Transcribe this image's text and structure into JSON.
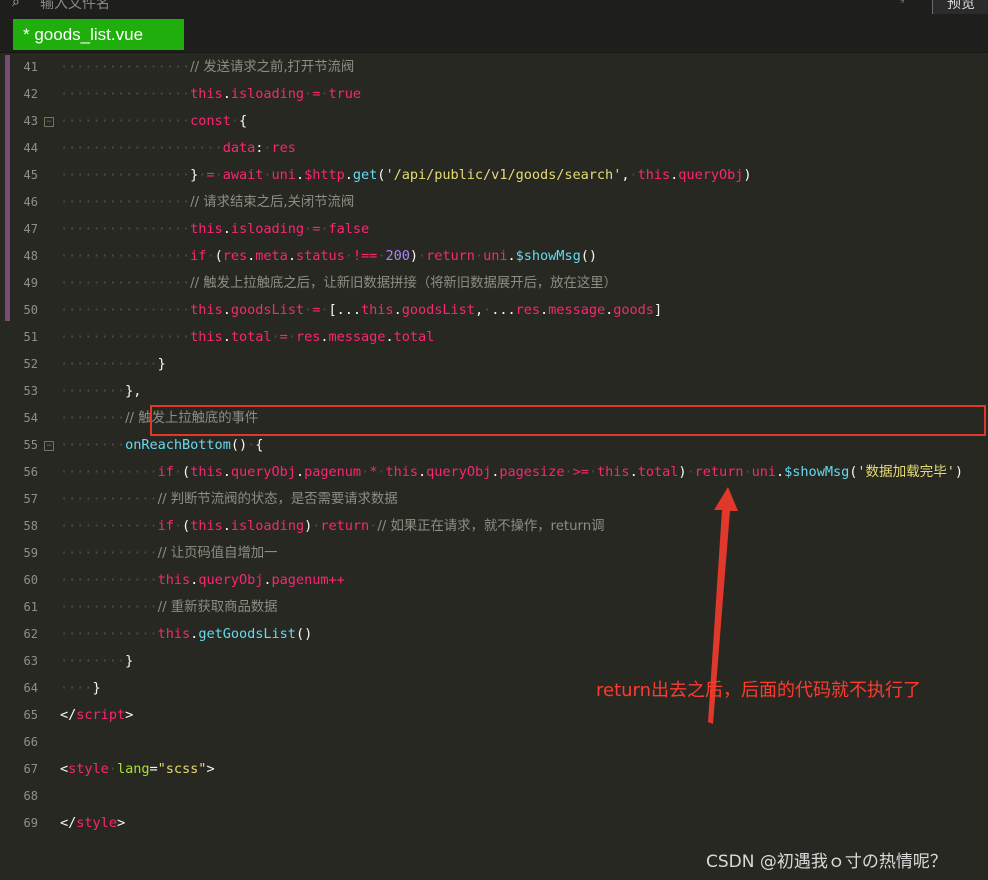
{
  "toolbar": {
    "search_placeholder": "输入文件名",
    "preview_label": "预览"
  },
  "tab": {
    "label": "* goods_list.vue"
  },
  "lines": [
    {
      "num": "41",
      "fold": false,
      "tokens": [
        [
          "ind",
          "················"
        ],
        [
          "cm",
          "// 发送请求之前,打开节流阀"
        ]
      ]
    },
    {
      "num": "42",
      "fold": false,
      "tokens": [
        [
          "ind",
          "················"
        ],
        [
          "kw",
          "this"
        ],
        [
          "pl",
          "."
        ],
        [
          "prop",
          "isloading"
        ],
        [
          "ind",
          "·"
        ],
        [
          "op",
          "="
        ],
        [
          "ind",
          "·"
        ],
        [
          "bool",
          "true"
        ]
      ]
    },
    {
      "num": "43",
      "fold": true,
      "tokens": [
        [
          "ind",
          "················"
        ],
        [
          "kw",
          "const"
        ],
        [
          "ind",
          "·"
        ],
        [
          "pl",
          "{"
        ]
      ]
    },
    {
      "num": "44",
      "fold": false,
      "tokens": [
        [
          "ind",
          "····················"
        ],
        [
          "prop",
          "data"
        ],
        [
          "pl",
          ":"
        ],
        [
          "ind",
          "·"
        ],
        [
          "var",
          "res"
        ]
      ]
    },
    {
      "num": "45",
      "fold": false,
      "tokens": [
        [
          "ind",
          "················"
        ],
        [
          "pl",
          "}"
        ],
        [
          "ind",
          "·"
        ],
        [
          "op",
          "="
        ],
        [
          "ind",
          "·"
        ],
        [
          "kw",
          "await"
        ],
        [
          "ind",
          "·"
        ],
        [
          "var",
          "uni"
        ],
        [
          "pl",
          "."
        ],
        [
          "var",
          "$http"
        ],
        [
          "pl",
          "."
        ],
        [
          "fn",
          "get"
        ],
        [
          "pl",
          "("
        ],
        [
          "str",
          "'/api/public/v1/goods/search'"
        ],
        [
          "pl",
          ","
        ],
        [
          "ind",
          "·"
        ],
        [
          "kw",
          "this"
        ],
        [
          "pl",
          "."
        ],
        [
          "prop",
          "queryObj"
        ],
        [
          "pl",
          ")"
        ]
      ]
    },
    {
      "num": "46",
      "fold": false,
      "tokens": [
        [
          "ind",
          "················"
        ],
        [
          "cm",
          "// 请求结束之后,关闭节流阀"
        ]
      ]
    },
    {
      "num": "47",
      "fold": false,
      "tokens": [
        [
          "ind",
          "················"
        ],
        [
          "kw",
          "this"
        ],
        [
          "pl",
          "."
        ],
        [
          "prop",
          "isloading"
        ],
        [
          "ind",
          "·"
        ],
        [
          "op",
          "="
        ],
        [
          "ind",
          "·"
        ],
        [
          "bool",
          "false"
        ]
      ]
    },
    {
      "num": "48",
      "fold": false,
      "tokens": [
        [
          "ind",
          "················"
        ],
        [
          "kw",
          "if"
        ],
        [
          "ind",
          "·"
        ],
        [
          "pl",
          "("
        ],
        [
          "var",
          "res"
        ],
        [
          "pl",
          "."
        ],
        [
          "prop",
          "meta"
        ],
        [
          "pl",
          "."
        ],
        [
          "prop",
          "status"
        ],
        [
          "ind",
          "·"
        ],
        [
          "op",
          "!=="
        ],
        [
          "ind",
          "·"
        ],
        [
          "num",
          "200"
        ],
        [
          "pl",
          ")"
        ],
        [
          "ind",
          "·"
        ],
        [
          "kw",
          "return"
        ],
        [
          "ind",
          "·"
        ],
        [
          "var",
          "uni"
        ],
        [
          "pl",
          "."
        ],
        [
          "fn",
          "$showMsg"
        ],
        [
          "pl",
          "()"
        ]
      ]
    },
    {
      "num": "49",
      "fold": false,
      "tokens": [
        [
          "ind",
          "················"
        ],
        [
          "cm",
          "// 触发上拉触底之后，让新旧数据拼接（将新旧数据展开后，放在这里）"
        ]
      ]
    },
    {
      "num": "50",
      "fold": false,
      "tokens": [
        [
          "ind",
          "················"
        ],
        [
          "kw",
          "this"
        ],
        [
          "pl",
          "."
        ],
        [
          "prop",
          "goodsList"
        ],
        [
          "ind",
          "·"
        ],
        [
          "op",
          "="
        ],
        [
          "ind",
          "·"
        ],
        [
          "pl",
          "[..."
        ],
        [
          "kw",
          "this"
        ],
        [
          "pl",
          "."
        ],
        [
          "prop",
          "goodsList"
        ],
        [
          "pl",
          ","
        ],
        [
          "ind",
          "·"
        ],
        [
          "pl",
          "..."
        ],
        [
          "var",
          "res"
        ],
        [
          "pl",
          "."
        ],
        [
          "prop",
          "message"
        ],
        [
          "pl",
          "."
        ],
        [
          "prop",
          "goods"
        ],
        [
          "pl",
          "]"
        ]
      ]
    },
    {
      "num": "51",
      "fold": false,
      "tokens": [
        [
          "ind",
          "················"
        ],
        [
          "kw",
          "this"
        ],
        [
          "pl",
          "."
        ],
        [
          "prop",
          "total"
        ],
        [
          "ind",
          "·"
        ],
        [
          "op",
          "="
        ],
        [
          "ind",
          "·"
        ],
        [
          "var",
          "res"
        ],
        [
          "pl",
          "."
        ],
        [
          "prop",
          "message"
        ],
        [
          "pl",
          "."
        ],
        [
          "prop",
          "total"
        ]
      ]
    },
    {
      "num": "52",
      "fold": false,
      "tokens": [
        [
          "ind",
          "············"
        ],
        [
          "pl",
          "}"
        ]
      ]
    },
    {
      "num": "53",
      "fold": false,
      "tokens": [
        [
          "ind",
          "········"
        ],
        [
          "pl",
          "},"
        ]
      ]
    },
    {
      "num": "54",
      "fold": false,
      "tokens": [
        [
          "ind",
          "········"
        ],
        [
          "cm",
          "// 触发上拉触底的事件"
        ]
      ]
    },
    {
      "num": "55",
      "fold": true,
      "tokens": [
        [
          "ind",
          "········"
        ],
        [
          "fn",
          "onReachBottom"
        ],
        [
          "pl",
          "()"
        ],
        [
          "ind",
          "·"
        ],
        [
          "pl",
          "{"
        ]
      ]
    },
    {
      "num": "56",
      "fold": false,
      "tokens": [
        [
          "ind",
          "············"
        ],
        [
          "kw",
          "if"
        ],
        [
          "ind",
          "·"
        ],
        [
          "pl",
          "("
        ],
        [
          "kw",
          "this"
        ],
        [
          "pl",
          "."
        ],
        [
          "prop",
          "queryObj"
        ],
        [
          "pl",
          "."
        ],
        [
          "prop",
          "pagenum"
        ],
        [
          "ind",
          "·"
        ],
        [
          "op",
          "*"
        ],
        [
          "ind",
          "·"
        ],
        [
          "kw",
          "this"
        ],
        [
          "pl",
          "."
        ],
        [
          "prop",
          "queryObj"
        ],
        [
          "pl",
          "."
        ],
        [
          "prop",
          "pagesize"
        ],
        [
          "ind",
          "·"
        ],
        [
          "op",
          ">="
        ],
        [
          "ind",
          "·"
        ],
        [
          "kw",
          "this"
        ],
        [
          "pl",
          "."
        ],
        [
          "prop",
          "total"
        ],
        [
          "pl",
          ")"
        ],
        [
          "ind",
          "·"
        ],
        [
          "kw",
          "return"
        ],
        [
          "ind",
          "·"
        ],
        [
          "var",
          "uni"
        ],
        [
          "pl",
          "."
        ],
        [
          "fn",
          "$showMsg"
        ],
        [
          "pl",
          "("
        ],
        [
          "str",
          "'数据加载完毕'"
        ],
        [
          "pl",
          ")"
        ]
      ]
    },
    {
      "num": "57",
      "fold": false,
      "tokens": [
        [
          "ind",
          "············"
        ],
        [
          "cm",
          "// 判断节流阀的状态，是否需要请求数据"
        ]
      ]
    },
    {
      "num": "58",
      "fold": false,
      "tokens": [
        [
          "ind",
          "············"
        ],
        [
          "kw",
          "if"
        ],
        [
          "ind",
          "·"
        ],
        [
          "pl",
          "("
        ],
        [
          "kw",
          "this"
        ],
        [
          "pl",
          "."
        ],
        [
          "prop",
          "isloading"
        ],
        [
          "pl",
          ")"
        ],
        [
          "ind",
          "·"
        ],
        [
          "kw",
          "return"
        ],
        [
          "ind",
          "·"
        ],
        [
          "cm",
          "// 如果正在请求，就不操作，return调"
        ]
      ]
    },
    {
      "num": "59",
      "fold": false,
      "tokens": [
        [
          "ind",
          "············"
        ],
        [
          "cm",
          "// 让页码值自增加一"
        ]
      ]
    },
    {
      "num": "60",
      "fold": false,
      "tokens": [
        [
          "ind",
          "············"
        ],
        [
          "kw",
          "this"
        ],
        [
          "pl",
          "."
        ],
        [
          "prop",
          "queryObj"
        ],
        [
          "pl",
          "."
        ],
        [
          "prop",
          "pagenum"
        ],
        [
          "op",
          "++"
        ]
      ]
    },
    {
      "num": "61",
      "fold": false,
      "tokens": [
        [
          "ind",
          "············"
        ],
        [
          "cm",
          "// 重新获取商品数据"
        ]
      ]
    },
    {
      "num": "62",
      "fold": false,
      "tokens": [
        [
          "ind",
          "············"
        ],
        [
          "kw",
          "this"
        ],
        [
          "pl",
          "."
        ],
        [
          "fn",
          "getGoodsList"
        ],
        [
          "pl",
          "()"
        ]
      ]
    },
    {
      "num": "63",
      "fold": false,
      "tokens": [
        [
          "ind",
          "········"
        ],
        [
          "pl",
          "}"
        ]
      ]
    },
    {
      "num": "64",
      "fold": false,
      "tokens": [
        [
          "ind",
          "····"
        ],
        [
          "pl",
          "}"
        ]
      ]
    },
    {
      "num": "65",
      "fold": false,
      "tokens": [
        [
          "pl",
          "</"
        ],
        [
          "tag",
          "script"
        ],
        [
          "pl",
          ">"
        ]
      ]
    },
    {
      "num": "66",
      "fold": false,
      "tokens": []
    },
    {
      "num": "67",
      "fold": false,
      "tokens": [
        [
          "pl",
          "<"
        ],
        [
          "tag",
          "style"
        ],
        [
          "ind",
          "·"
        ],
        [
          "attr",
          "lang"
        ],
        [
          "pl",
          "="
        ],
        [
          "str",
          "\"scss\""
        ],
        [
          "pl",
          ">"
        ]
      ]
    },
    {
      "num": "68",
      "fold": false,
      "tokens": []
    },
    {
      "num": "69",
      "fold": false,
      "tokens": [
        [
          "pl",
          "</"
        ],
        [
          "tag",
          "style"
        ],
        [
          "pl",
          ">"
        ]
      ]
    }
  ],
  "annotation": {
    "text": "return出去之后，后面的代码就不执行了"
  },
  "watermark": {
    "text": "CSDN @初遇我ｏ寸の热情呢？"
  },
  "colors": {
    "tab_bg": "#1fae0c",
    "highlight": "#e0392b",
    "annotation": "#ff3a2e"
  }
}
